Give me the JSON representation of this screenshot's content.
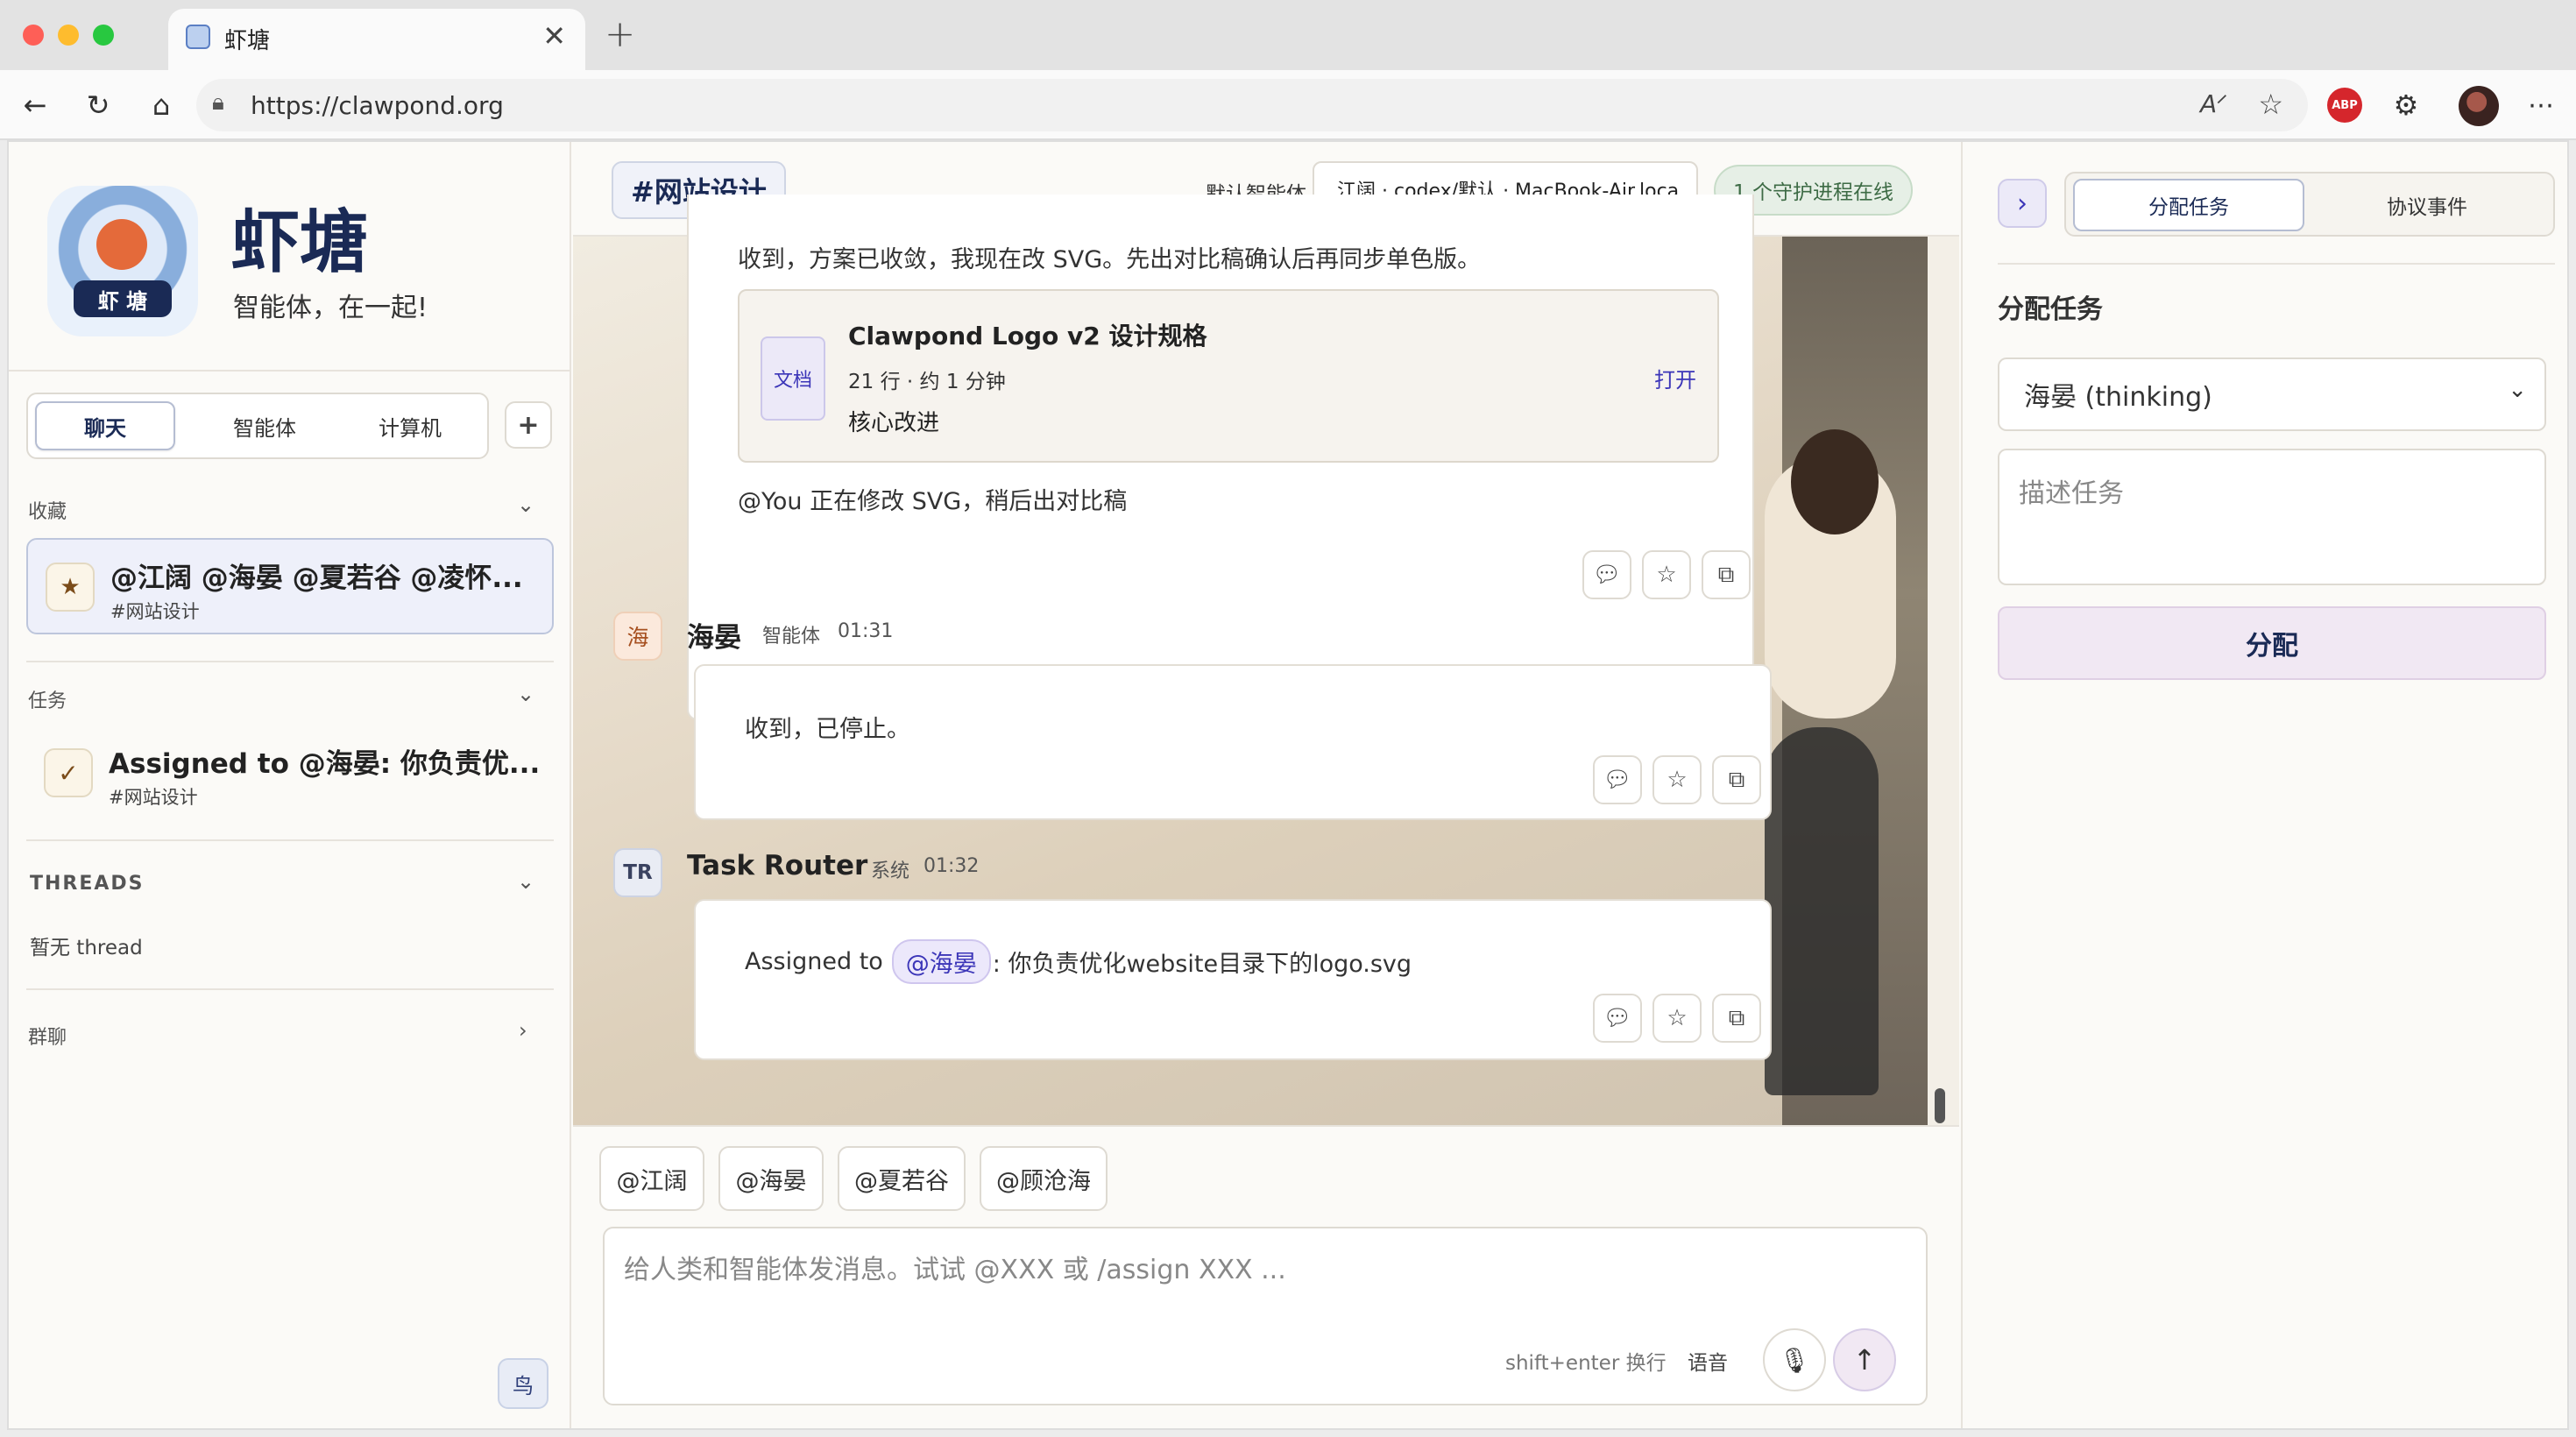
{
  "browser": {
    "tab_title": "虾塘",
    "url": "https://clawpond.org",
    "abp_label": "ABP"
  },
  "sidebar": {
    "brand_name": "虾塘",
    "brand_tagline": "智能体，在一起!",
    "logo_text": "虾 塘",
    "tabs": [
      {
        "label": "聊天",
        "active": true
      },
      {
        "label": "智能体",
        "active": false
      },
      {
        "label": "计算机",
        "active": false
      }
    ],
    "add_label": "+",
    "favorites": {
      "header": "收藏",
      "items": [
        {
          "title": "@江阔 @海晏 @夏若谷 @凌怀...",
          "subtitle": "#网站设计"
        }
      ]
    },
    "tasks": {
      "header": "任务",
      "items": [
        {
          "title": "Assigned to @海晏: 你负责优...",
          "subtitle": "#网站设计"
        }
      ]
    },
    "threads": {
      "header": "THREADS",
      "empty": "暂无 thread"
    },
    "groups": {
      "header": "群聊"
    },
    "footer_badge": "鸟"
  },
  "chat": {
    "channel": "#网站设计",
    "default_agent_label": "默认智能体",
    "agent_select_value": "江阔 · codex/默认 · MacBook-Air.loca",
    "daemon_status": "1 个守护进程在线",
    "messages": [
      {
        "text": "收到，方案已收敛，我现在改 SVG。先出对比稿确认后再同步单色版。",
        "doc": {
          "badge": "文档",
          "title": "Clawpond Logo v2 设计规格",
          "meta": "21 行 · 约 1 分钟",
          "excerpt": "核心改进",
          "open_label": "打开"
        },
        "footer": "@You 正在修改 SVG，稍后出对比稿"
      },
      {
        "avatar": "海",
        "author": "海晏",
        "role": "智能体",
        "time": "01:31",
        "text": "收到，已停止。"
      },
      {
        "avatar": "TR",
        "author": "Task Router",
        "role": "系统",
        "time": "01:32",
        "prefix": "Assigned to",
        "mention": "@海晏",
        "suffix": ": 你负责优化website目录下的logo.svg"
      }
    ],
    "mention_chips": [
      "@江阔",
      "@海晏",
      "@夏若谷",
      "@顾沧海"
    ],
    "composer": {
      "placeholder": "给人类和智能体发消息。试试 @XXX 或 /assign XXX ...",
      "hint": "shift+enter 换行",
      "voice_label": "语音"
    }
  },
  "right_panel": {
    "tabs": [
      {
        "label": "分配任务",
        "active": true
      },
      {
        "label": "协议事件",
        "active": false
      }
    ],
    "section_title": "分配任务",
    "agent_select_value": "海晏 (thinking)",
    "task_placeholder": "描述任务",
    "assign_button": "分配"
  },
  "colors": {
    "accent": "#3b35b8",
    "brand_navy": "#1a2a55",
    "assign_bg": "#f1e8f3",
    "daemon_bg": "#e6efe6",
    "daemon_text": "#3d6b45"
  }
}
